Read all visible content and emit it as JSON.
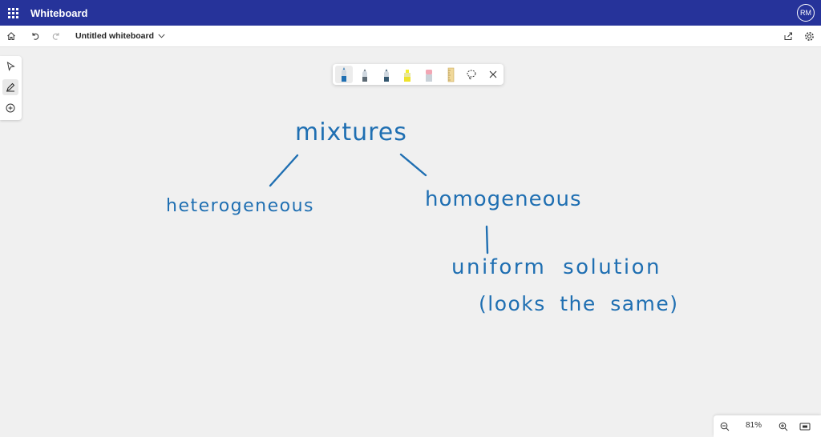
{
  "app": {
    "title": "Whiteboard",
    "user_initials": "RM"
  },
  "toolbar": {
    "doc_title": "Untitled whiteboard"
  },
  "canvas": {
    "words": [
      "mixtures",
      "heterogeneous",
      "homogeneous",
      "uniform solution",
      "(looks the same)"
    ]
  },
  "zoom": {
    "level": "81%"
  },
  "colors": {
    "titlebar": "#26339a",
    "ink": "#1f6fb2"
  }
}
